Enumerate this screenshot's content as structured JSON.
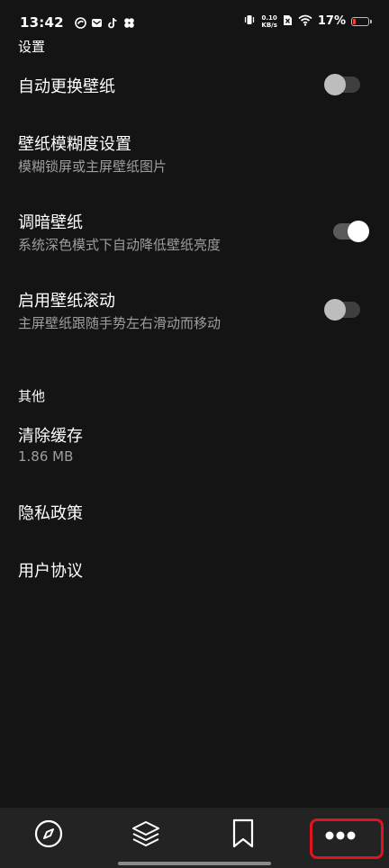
{
  "status_bar": {
    "time": "13:42",
    "net_speed_value": "0.10",
    "net_speed_unit": "KB/s",
    "battery_text": "17%",
    "battery_level": 0.17,
    "battery_color": "#ff3b30"
  },
  "settings_section": {
    "title": "设置",
    "items": [
      {
        "title": "自动更换壁纸",
        "subtitle": "",
        "toggle": "off"
      },
      {
        "title": "壁纸模糊度设置",
        "subtitle": "模糊锁屏或主屏壁纸图片"
      },
      {
        "title": "调暗壁纸",
        "subtitle": "系统深色模式下自动降低壁纸亮度",
        "toggle": "on"
      },
      {
        "title": "启用壁纸滚动",
        "subtitle": "主屏壁纸跟随手势左右滑动而移动",
        "toggle": "off"
      }
    ]
  },
  "other_section": {
    "title": "其他",
    "items": [
      {
        "title": "清除缓存",
        "subtitle": "1.86 MB"
      },
      {
        "title": "隐私政策"
      },
      {
        "title": "用户协议"
      }
    ]
  },
  "bottom_nav": {
    "items": [
      {
        "icon": "compass-icon"
      },
      {
        "icon": "layers-icon"
      },
      {
        "icon": "bookmark-icon"
      },
      {
        "icon": "more-icon",
        "highlighted": true
      }
    ],
    "highlight_color": "#e0141e"
  }
}
